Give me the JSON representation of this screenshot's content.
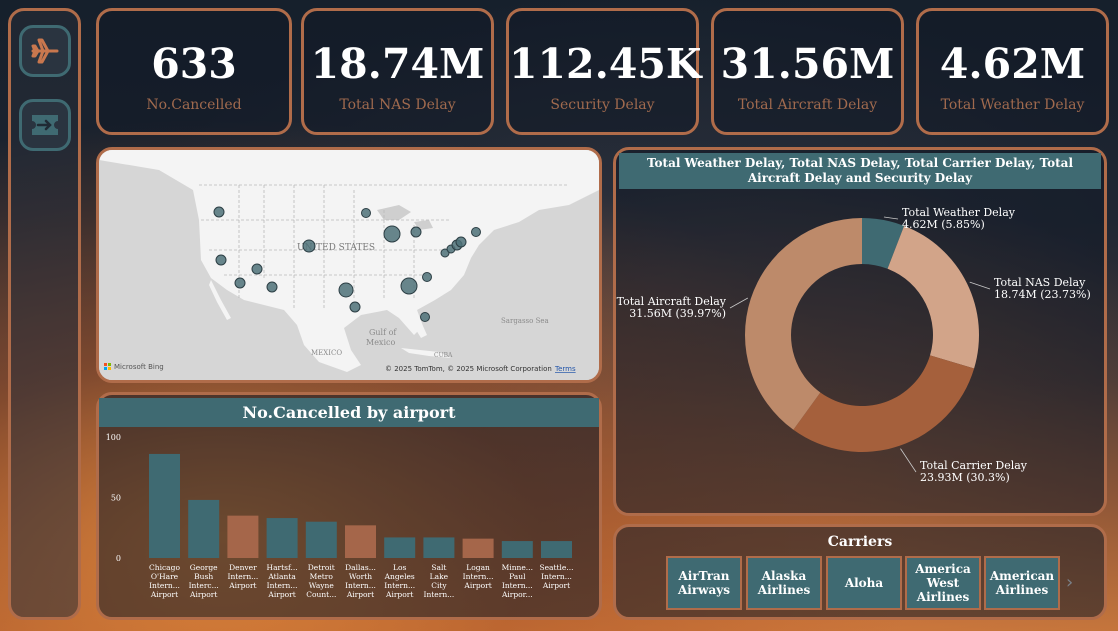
{
  "sidebar": {
    "items": [
      {
        "icon": "airplane-icon"
      },
      {
        "icon": "ticket-icon"
      }
    ]
  },
  "kpis": [
    {
      "value": "633",
      "label": "No.Cancelled"
    },
    {
      "value": "18.74M",
      "label": "Total NAS Delay"
    },
    {
      "value": "112.45K",
      "label": "Security Delay"
    },
    {
      "value": "31.56M",
      "label": "Total Aircraft Delay"
    },
    {
      "value": "4.62M",
      "label": "Total Weather Delay"
    }
  ],
  "map": {
    "country_label": "UNITED STATES",
    "gulf_label": "Gulf of Mexico",
    "mexico_label": "MEXICO",
    "cuba_label": "CUBA",
    "sea_label": "Sargasso Sea",
    "logo_text": "Microsoft Bing",
    "copyright": "© 2025 TomTom, © 2025 Microsoft Corporation",
    "terms_link": "Terms"
  },
  "bar_chart": {
    "title": "No.Cancelled by airport",
    "colors": {
      "teal": "#3f6a72",
      "brown": "#a5664a"
    }
  },
  "donut_chart": {
    "title": "Total Weather Delay, Total NAS Delay, Total Carrier Delay, Total Aircraft Delay and Security Delay",
    "slices": [
      {
        "name": "Total Weather Delay",
        "label": "4.62M (5.85%)",
        "color": "#3f6a72"
      },
      {
        "name": "Total NAS Delay",
        "label": "18.74M (23.73%)",
        "color": "#d2a489"
      },
      {
        "name": "Total Carrier Delay",
        "label": "23.93M (30.3%)",
        "color": "#a5603c"
      },
      {
        "name": "Total Aircraft Delay",
        "label": "31.56M (39.97%)",
        "color": "#bd8a6a"
      }
    ]
  },
  "carriers": {
    "title": "Carriers",
    "items": [
      "AirTran Airways",
      "Alaska Airlines",
      "Aloha",
      "America West Airlines",
      "American Airlines"
    ],
    "next_glyph": "›"
  },
  "chart_data": [
    {
      "type": "bar",
      "title": "No.Cancelled by airport",
      "categories": [
        "Chicago O'Hare Intern... Airport",
        "George Bush Interc... Airport",
        "Denver Intern... Airport",
        "Hartsf... Atlanta Intern... Airport",
        "Detroit Metro Wayne Count...",
        "Dallas... Worth Intern... Airport",
        "Los Angeles Intern... Airport",
        "Salt Lake City Intern...",
        "Logan Intern... Airport",
        "Minne... Paul Intern... Airpor...",
        "Seattle... Intern... Airport"
      ],
      "category_lines": [
        [
          "Chicago",
          "O'Hare",
          "Intern...",
          "Airport"
        ],
        [
          "George",
          "Bush",
          "Interc...",
          "Airport"
        ],
        [
          "Denver",
          "Intern...",
          "Airport"
        ],
        [
          "Hartsf...",
          "Atlanta",
          "Intern...",
          "Airport"
        ],
        [
          "Detroit",
          "Metro",
          "Wayne",
          "Count..."
        ],
        [
          "Dallas...",
          "Worth",
          "Intern...",
          "Airport"
        ],
        [
          "Los",
          "Angeles",
          "Intern...",
          "Airport"
        ],
        [
          "Salt",
          "Lake",
          "City",
          "Intern..."
        ],
        [
          "Logan",
          "Intern...",
          "Airport"
        ],
        [
          "Minne...",
          "Paul",
          "Intern...",
          "Airpor..."
        ],
        [
          "Seattle...",
          "Intern...",
          "Airport"
        ]
      ],
      "values": [
        86,
        48,
        35,
        33,
        30,
        27,
        17,
        17,
        16,
        14,
        14
      ],
      "bar_colors": [
        "teal",
        "teal",
        "brown",
        "teal",
        "teal",
        "brown",
        "teal",
        "teal",
        "brown",
        "teal",
        "teal"
      ],
      "ylim": [
        0,
        100
      ],
      "yticks": [
        0,
        50,
        100
      ],
      "xlabel": "",
      "ylabel": ""
    },
    {
      "type": "pie",
      "title": "Total Weather Delay, Total NAS Delay, Total Carrier Delay, Total Aircraft Delay and Security Delay",
      "categories": [
        "Total Weather Delay",
        "Total NAS Delay",
        "Total Carrier Delay",
        "Total Aircraft Delay"
      ],
      "values": [
        4.62,
        18.74,
        23.93,
        31.56
      ],
      "units": "M",
      "percentages": [
        5.85,
        23.73,
        30.3,
        39.97
      ],
      "donut": true
    }
  ]
}
